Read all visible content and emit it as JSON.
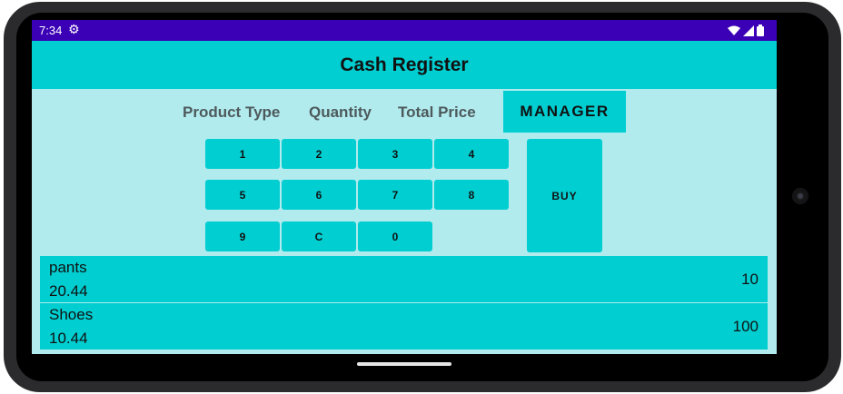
{
  "status_bar": {
    "time": "7:34",
    "settings_icon": "gear-icon",
    "icons": [
      "wifi-icon",
      "signal-icon",
      "battery-icon"
    ],
    "bg_color": "#3b00b5"
  },
  "app_bar": {
    "title": "Cash Register",
    "bg_color": "#00ced1"
  },
  "header": {
    "product_type_label": "Product Type",
    "quantity_label": "Quantity",
    "total_price_label": "Total Price",
    "manager_label": "MANAGER"
  },
  "keypad": {
    "keys": [
      "1",
      "2",
      "3",
      "4",
      "5",
      "6",
      "7",
      "8",
      "9",
      "C",
      "0"
    ],
    "buy_label": "BUY"
  },
  "products": [
    {
      "name": "pants",
      "price": "20.44",
      "quantity": "10"
    },
    {
      "name": "Shoes",
      "price": "10.44",
      "quantity": "100"
    }
  ],
  "colors": {
    "accent": "#00ced1",
    "background": "#b2ebee"
  }
}
